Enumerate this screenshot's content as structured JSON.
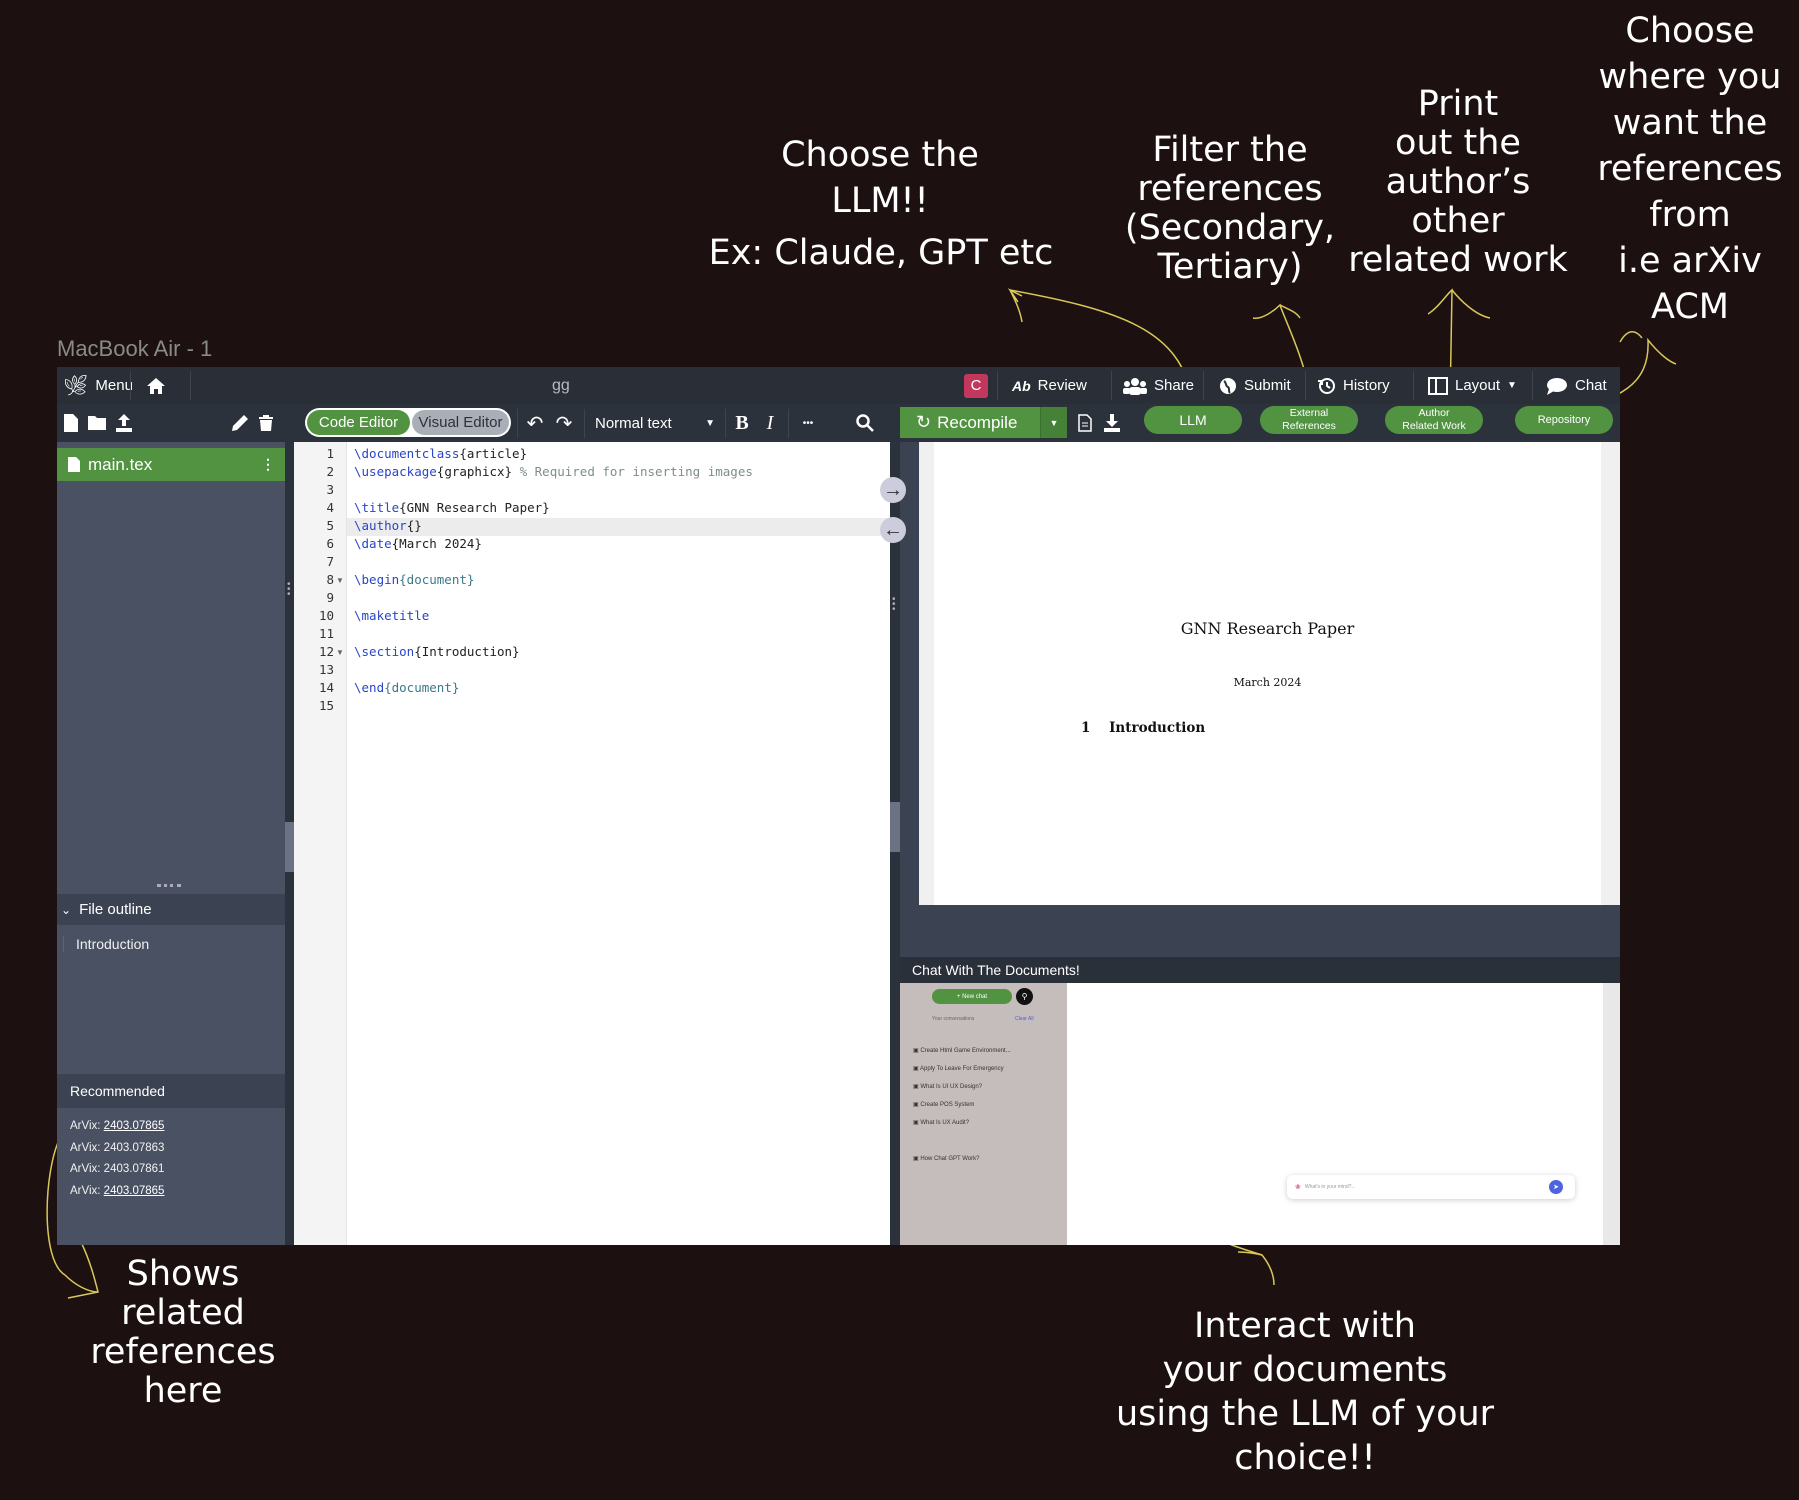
{
  "annotations": {
    "llm": "Choose the\nLLM!!",
    "llm_example": "Ex: Claude, GPT etc",
    "filter": "Filter the\nreferences\n(Secondary,\nTertiary)",
    "author": "Print\nout the\nauthor’s\nother\nrelated work",
    "repository": "Choose\nwhere you\nwant the\nreferences\nfrom\ni.e arXiv\nACM",
    "recommended": "Shows\nrelated\nreferences\nhere",
    "chat": "Interact with\nyour documents\nusing the LLM of your\nchoice!!"
  },
  "frame_label": "MacBook Air - 1",
  "topbar": {
    "menu_label": "Menu",
    "project_title": "gg",
    "avatar_letter": "C",
    "review_label": "Review",
    "share_label": "Share",
    "submit_label": "Submit",
    "history_label": "History",
    "layout_label": "Layout",
    "chat_label": "Chat"
  },
  "toolbar": {
    "code_editor_label": "Code Editor",
    "visual_editor_label": "Visual Editor",
    "text_style": "Normal text",
    "bold_label": "B",
    "italic_label": "I",
    "more_label": "•••",
    "recompile_label": "Recompile",
    "llm_label": "LLM",
    "external_refs_label": "External\nReferences",
    "author_work_label": "Author\nRelated Work",
    "repository_label": "Repository"
  },
  "sidebar": {
    "file_name": "main.tex",
    "outline_title": "File outline",
    "outline_items": [
      "Introduction"
    ],
    "recommended_title": "Recommended",
    "recommended": [
      {
        "prefix": "ArVix: ",
        "id": "2403.07865"
      },
      {
        "prefix": "ArVix: ",
        "id": "2403.07863"
      },
      {
        "prefix": "ArVix: ",
        "id": "2403.07861"
      },
      {
        "prefix": "ArVix: ",
        "id": "2403.07865"
      }
    ]
  },
  "editor": {
    "line_numbers": [
      "1",
      "2",
      "3",
      "4",
      "5",
      "6",
      "7",
      "8",
      "9",
      "10",
      "11",
      "12",
      "13",
      "14",
      "15"
    ],
    "lines": {
      "l1_cmd": "\\documentclass",
      "l1_arg": "{article}",
      "l2_cmd": "\\usepackage",
      "l2_arg": "{graphicx}",
      "l2_comment": " % Required for inserting images",
      "l4_cmd": "\\title",
      "l4_arg": "{GNN Research Paper}",
      "l5_cmd": "\\author",
      "l5_arg": "{}",
      "l6_cmd": "\\date",
      "l6_arg": "{March 2024}",
      "l8_cmd": "\\begin",
      "l8_arg": "{document}",
      "l10_cmd": "\\maketitle",
      "l12_cmd": "\\section",
      "l12_arg": "{Introduction}",
      "l14_cmd": "\\end",
      "l14_arg": "{document}"
    }
  },
  "pdf": {
    "title": "GNN Research Paper",
    "date": "March 2024",
    "section_number": "1",
    "section_title": "Introduction"
  },
  "chat": {
    "title": "Chat With The Documents!",
    "new_chat_label": "+ New chat",
    "conversations_label": "Your conversations",
    "clear_all_label": "Clear All",
    "conversations": [
      "Create Html Game Environment...",
      "Apply To Leave For Emergency",
      "What Is UI UX Design?",
      "Create POS System",
      "What Is UX Audit?",
      "How Chat GPT Work?"
    ],
    "input_placeholder": "What's in your mind?..."
  },
  "colors": {
    "background": "#1c1010",
    "green_accent": "#529342",
    "topbar": "#292e37",
    "sidebar": "#495163"
  }
}
